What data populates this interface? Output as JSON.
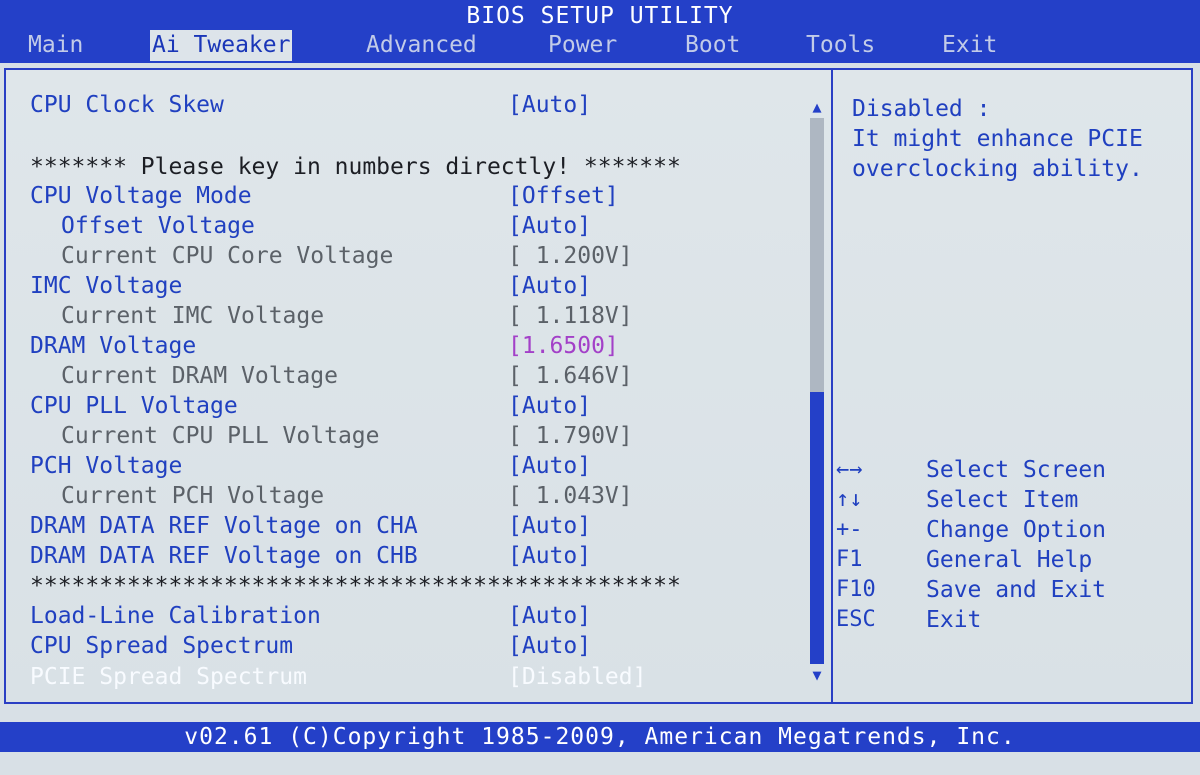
{
  "title": "BIOS SETUP UTILITY",
  "menu": [
    {
      "label": "Main"
    },
    {
      "label": "Ai Tweaker"
    },
    {
      "label": "Advanced"
    },
    {
      "label": "Power"
    },
    {
      "label": "Boot"
    },
    {
      "label": "Tools"
    },
    {
      "label": "Exit"
    }
  ],
  "settings": {
    "cpu_clock_skew": {
      "label": "CPU Clock Skew",
      "value": "[Auto]"
    },
    "banner_top": "******* Please key in numbers directly! *******",
    "cpu_voltage_mode": {
      "label": "CPU Voltage Mode",
      "value": "[Offset]"
    },
    "offset_voltage": {
      "label": "Offset Voltage",
      "value": "[Auto]"
    },
    "current_cpu_core_voltage": {
      "label": "Current CPU Core Voltage",
      "value": "[ 1.200V]"
    },
    "imc_voltage": {
      "label": "IMC Voltage",
      "value": "[Auto]"
    },
    "current_imc_voltage": {
      "label": "Current IMC Voltage",
      "value": "[ 1.118V]"
    },
    "dram_voltage": {
      "label": "DRAM Voltage",
      "value": "[1.6500]"
    },
    "current_dram_voltage": {
      "label": "Current DRAM Voltage",
      "value": "[ 1.646V]"
    },
    "cpu_pll_voltage": {
      "label": "CPU PLL Voltage",
      "value": "[Auto]"
    },
    "current_cpu_pll_voltage": {
      "label": "Current CPU PLL Voltage",
      "value": "[ 1.790V]"
    },
    "pch_voltage": {
      "label": "PCH Voltage",
      "value": "[Auto]"
    },
    "current_pch_voltage": {
      "label": "Current PCH Voltage",
      "value": "[ 1.043V]"
    },
    "dram_data_ref_cha": {
      "label": "DRAM DATA REF Voltage on CHA",
      "value": "[Auto]"
    },
    "dram_data_ref_chb": {
      "label": "DRAM DATA REF Voltage on CHB",
      "value": "[Auto]"
    },
    "banner_separator": "***********************************************",
    "load_line_calibration": {
      "label": "Load-Line Calibration",
      "value": "[Auto]"
    },
    "cpu_spread_spectrum": {
      "label": "CPU Spread Spectrum",
      "value": "[Auto]"
    },
    "pcie_spread_spectrum": {
      "label": "PCIE Spread Spectrum",
      "value": "[Disabled]"
    }
  },
  "help": {
    "text": "Disabled :\nIt might enhance PCIE\noverclocking ability."
  },
  "keys": [
    {
      "key": "←→",
      "desc": "Select Screen"
    },
    {
      "key": "↑↓",
      "desc": "Select Item"
    },
    {
      "key": "+-",
      "desc": "Change Option"
    },
    {
      "key": "F1",
      "desc": "General Help"
    },
    {
      "key": "F10",
      "desc": "Save and Exit"
    },
    {
      "key": "ESC",
      "desc": "Exit"
    }
  ],
  "scrollbar": {
    "up_arrow": "▲",
    "down_arrow": "▼"
  },
  "footer": "v02.61 (C)Copyright 1985-2009, American Megatrends, Inc.",
  "colors": {
    "bar_blue": "#2440c8",
    "setting_text": "#2040c0",
    "readonly_text": "#5b6168",
    "highlight_value": "#a340c8",
    "selected_text": "#f8fbff",
    "panel_background": "#d8e0e6"
  }
}
